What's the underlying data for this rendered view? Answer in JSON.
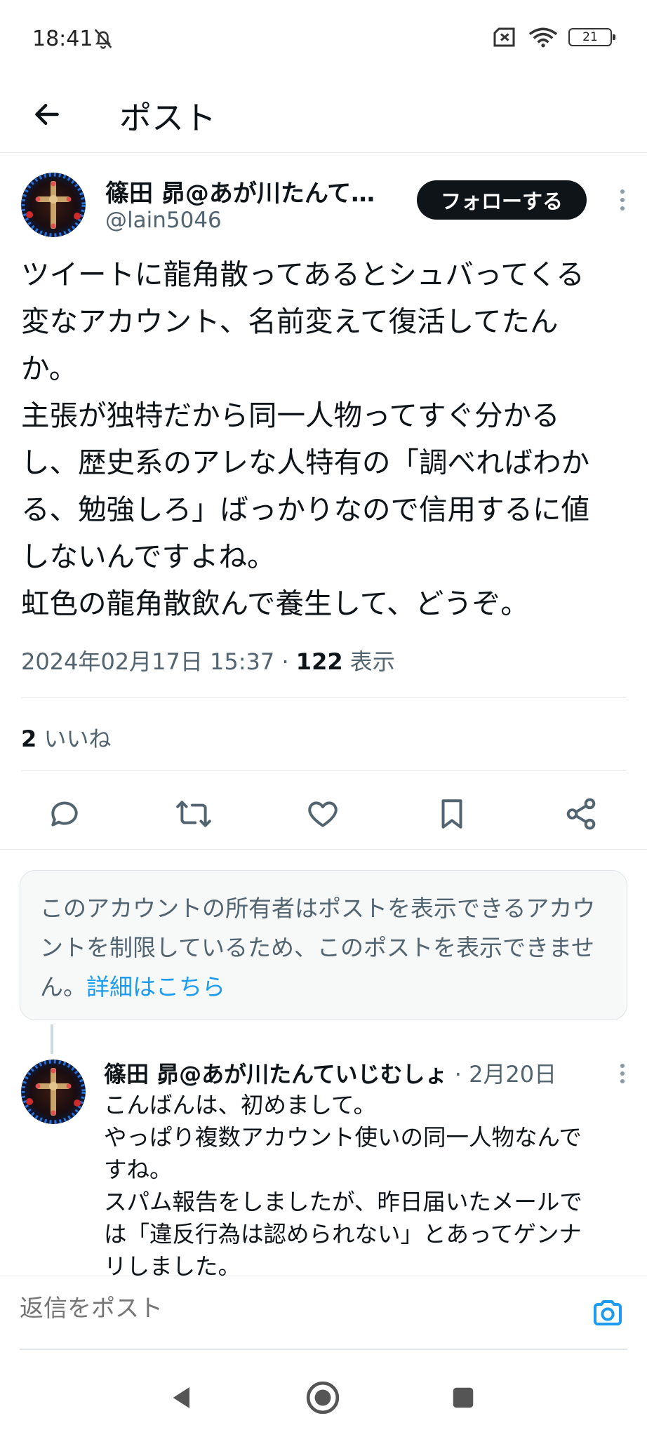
{
  "status": {
    "time": "18:41",
    "battery": "21",
    "icons": [
      "bell-off-icon",
      "no-sim-icon",
      "wifi-icon",
      "battery-icon"
    ]
  },
  "header": {
    "title": "ポスト"
  },
  "post": {
    "author_name": "篠田 昴@あが川たんて…",
    "author_handle": "@lain5046",
    "follow_label": "フォローする",
    "body_lines": [
      "ツイートに龍角散ってあるとシュバってくる",
      "変なアカウント、名前変えて復活してたん",
      "か。",
      "主張が独特だから同一人物ってすぐ分かる",
      "し、歴史系のアレな人特有の「調べればわか",
      "る、勉強しろ」ばっかりなので信用するに値",
      "しないんですよね。",
      "虹色の龍角散飲んで養生して、どうぞ。"
    ],
    "timestamp": "2024年02月17日 15:37",
    "separator": " · ",
    "views_count": "122",
    "views_label": " 表示",
    "likes_count": "2",
    "likes_label": " いいね"
  },
  "actions": [
    "reply-icon",
    "repost-icon",
    "like-icon",
    "bookmark-icon",
    "share-icon"
  ],
  "notice": {
    "text": "このアカウントの所有者はポストを表示できるアカウントを制限しているため、このポストを表示できません。",
    "link": "詳細はこちら"
  },
  "reply": {
    "author_name": "篠田 昴@あが川たんていじむしょ",
    "date": " · 2月20日",
    "body_lines": [
      "こんばんは、初めまして。",
      "やっぱり複数アカウント使いの同一人物なんで",
      "すね。",
      "スパム報告をしましたが、昨日届いたメールで",
      "は「違反行為は認められない」とあってゲンナ",
      "リしました。"
    ]
  },
  "compose": {
    "placeholder": "返信をポスト"
  },
  "colors": {
    "text": "#0f1419",
    "secondary": "#536471",
    "link": "#1d9bf0",
    "follow_bg": "#0f1419"
  }
}
